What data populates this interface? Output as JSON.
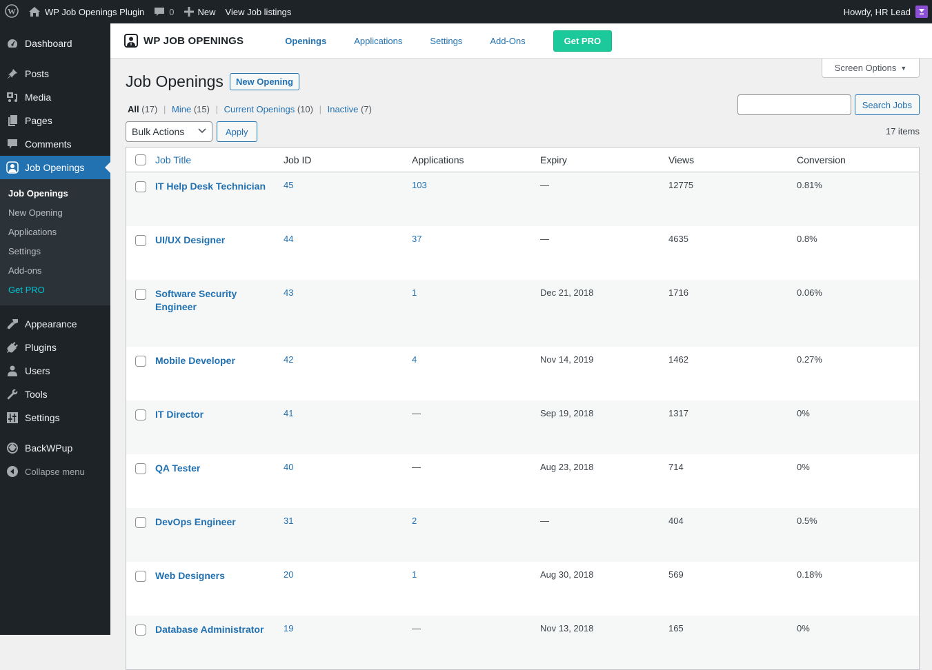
{
  "adminbar": {
    "site_name": "WP Job Openings Plugin",
    "comments_count": "0",
    "new_label": "New",
    "view_listings": "View Job listings",
    "greeting": "Howdy, HR Lead"
  },
  "sidebar": {
    "items": [
      {
        "label": "Dashboard",
        "icon": "dashboard-icon"
      },
      {
        "label": "Posts",
        "icon": "pin-icon"
      },
      {
        "label": "Media",
        "icon": "media-icon"
      },
      {
        "label": "Pages",
        "icon": "pages-icon"
      },
      {
        "label": "Comments",
        "icon": "comment-icon"
      },
      {
        "label": "Job Openings",
        "icon": "job-user-icon",
        "current": true
      },
      {
        "label": "Appearance",
        "icon": "brush-icon"
      },
      {
        "label": "Plugins",
        "icon": "plug-icon"
      },
      {
        "label": "Users",
        "icon": "user-icon"
      },
      {
        "label": "Tools",
        "icon": "wrench-icon"
      },
      {
        "label": "Settings",
        "icon": "sliders-icon"
      },
      {
        "label": "BackWPup",
        "icon": "backwpup-icon"
      },
      {
        "label": "Collapse menu",
        "icon": "collapse-icon"
      }
    ],
    "submenu": [
      {
        "label": "Job Openings",
        "current": true
      },
      {
        "label": "New Opening"
      },
      {
        "label": "Applications"
      },
      {
        "label": "Settings"
      },
      {
        "label": "Add-ons"
      },
      {
        "label": "Get PRO",
        "highlight": true
      }
    ]
  },
  "plugin_header": {
    "logo_text": "WP JOB OPENINGS",
    "nav": [
      "Openings",
      "Applications",
      "Settings",
      "Add-Ons"
    ],
    "active_nav": "Openings",
    "get_pro": "Get PRO"
  },
  "page": {
    "screen_options": "Screen Options",
    "title": "Job Openings",
    "new_opening": "New Opening",
    "filters": [
      {
        "label": "All",
        "count": "(17)",
        "current": true
      },
      {
        "label": "Mine",
        "count": "(15)"
      },
      {
        "label": "Current Openings",
        "count": "(10)"
      },
      {
        "label": "Inactive",
        "count": "(7)"
      }
    ],
    "search_placeholder": "",
    "search_button": "Search Jobs",
    "bulk_actions": "Bulk Actions",
    "apply": "Apply",
    "items_count": "17 items"
  },
  "table": {
    "columns": [
      "Job Title",
      "Job ID",
      "Applications",
      "Expiry",
      "Views",
      "Conversion"
    ],
    "rows": [
      {
        "title": "IT Help Desk Technician",
        "id": "45",
        "applications": "103",
        "expiry": "—",
        "views": "12775",
        "conversion": "0.81%"
      },
      {
        "title": "UI/UX Designer",
        "id": "44",
        "applications": "37",
        "expiry": "—",
        "views": "4635",
        "conversion": "0.8%"
      },
      {
        "title": "Software Security Engineer",
        "id": "43",
        "applications": "1",
        "expiry": "Dec 21, 2018",
        "views": "1716",
        "conversion": "0.06%"
      },
      {
        "title": "Mobile Developer",
        "id": "42",
        "applications": "4",
        "expiry": "Nov 14, 2019",
        "views": "1462",
        "conversion": "0.27%"
      },
      {
        "title": "IT Director",
        "id": "41",
        "applications": "—",
        "expiry": "Sep 19, 2018",
        "views": "1317",
        "conversion": "0%"
      },
      {
        "title": "QA Tester",
        "id": "40",
        "applications": "—",
        "expiry": "Aug 23, 2018",
        "views": "714",
        "conversion": "0%"
      },
      {
        "title": "DevOps Engineer",
        "id": "31",
        "applications": "2",
        "expiry": "—",
        "views": "404",
        "conversion": "0.5%"
      },
      {
        "title": "Web Designers",
        "id": "20",
        "applications": "1",
        "expiry": "Aug 30, 2018",
        "views": "569",
        "conversion": "0.18%"
      },
      {
        "title": "Database Administrator",
        "id": "19",
        "applications": "—",
        "expiry": "Nov 13, 2018",
        "views": "165",
        "conversion": "0%"
      }
    ]
  },
  "colors": {
    "accent": "#2271b1",
    "admin_dark": "#1d2327",
    "get_pro_green": "#1cc99b",
    "get_pro_sidebar": "#00c2d4"
  }
}
